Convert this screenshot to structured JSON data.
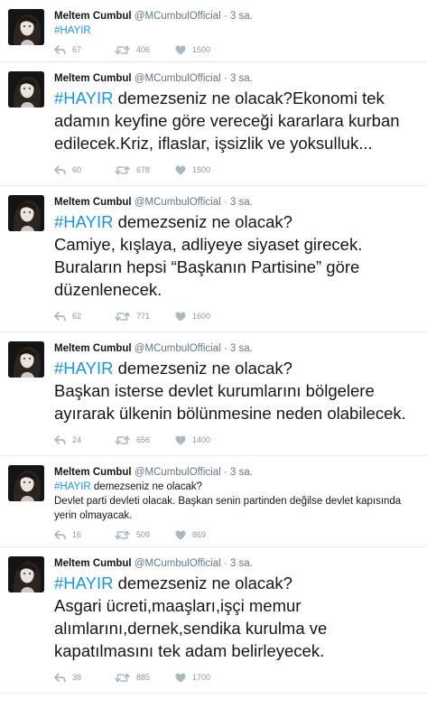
{
  "tweets": [
    {
      "id": "t1",
      "size": "small",
      "author": "Meltem Cumbul",
      "handle": "@MCumbulOfficial",
      "separator": "·",
      "time": "3 sa.",
      "hashtag": "#HAYIR",
      "text": "",
      "replies": "67",
      "retweets": "406",
      "likes": "1500"
    },
    {
      "id": "t2",
      "size": "big",
      "author": "Meltem Cumbul",
      "handle": "@MCumbulOfficial",
      "separator": "·",
      "time": "3 sa.",
      "hashtag": "#HAYIR",
      "text": " demezseniz ne olacak?Ekonomi tek adamın keyfine göre vereceği kararlara kurban edilecek.Kriz, iflaslar, işsizlik ve yoksulluk...",
      "replies": "60",
      "retweets": "678",
      "likes": "1500"
    },
    {
      "id": "t3",
      "size": "big",
      "author": "Meltem Cumbul",
      "handle": "@MCumbulOfficial",
      "separator": "·",
      "time": "3 sa.",
      "hashtag": "#HAYIR",
      "text": " demezseniz ne olacak?\nCamiye, kışlaya, adliyeye siyaset girecek. Buraların hepsi “Başkanın Partisine” göre düzenlenecek.",
      "replies": "62",
      "retweets": "771",
      "likes": "1600"
    },
    {
      "id": "t4",
      "size": "big",
      "author": "Meltem Cumbul",
      "handle": "@MCumbulOfficial",
      "separator": "·",
      "time": "3 sa.",
      "hashtag": "#HAYIR",
      "text": " demezseniz ne olacak?\nBaşkan isterse devlet kurumlarını bölgelere ayırarak ülkenin bölünmesine neden olabilecek.",
      "replies": "24",
      "retweets": "656",
      "likes": "1400"
    },
    {
      "id": "t5",
      "size": "small",
      "author": "Meltem Cumbul",
      "handle": "@MCumbulOfficial",
      "separator": "·",
      "time": "3 sa.",
      "hashtag": "#HAYIR",
      "text": " demezseniz ne olacak?\nDevlet parti devleti olacak. Başkan senin partinden değilse devlet kapısında yerin olmayacak.",
      "replies": "16",
      "retweets": "509",
      "likes": "869"
    },
    {
      "id": "t6",
      "size": "big",
      "author": "Meltem Cumbul",
      "handle": "@MCumbulOfficial",
      "separator": "·",
      "time": "3 sa.",
      "hashtag": "#HAYIR",
      "text": " demezseniz ne olacak?\nAsgari ücreti,maaşları,işçi memur alımlarını,dernek,sendika kurulma ve kapatılmasını tek adam belirleyecek.",
      "replies": "38",
      "retweets": "885",
      "likes": "1700"
    }
  ],
  "icons": {
    "reply": "reply-icon",
    "retweet": "retweet-icon",
    "like": "heart-icon",
    "avatar": "profile-photo"
  },
  "colors": {
    "hashtag": "#1b95e0",
    "meta": "#657786",
    "action": "#8899a6",
    "divider": "#e6ecf0"
  }
}
